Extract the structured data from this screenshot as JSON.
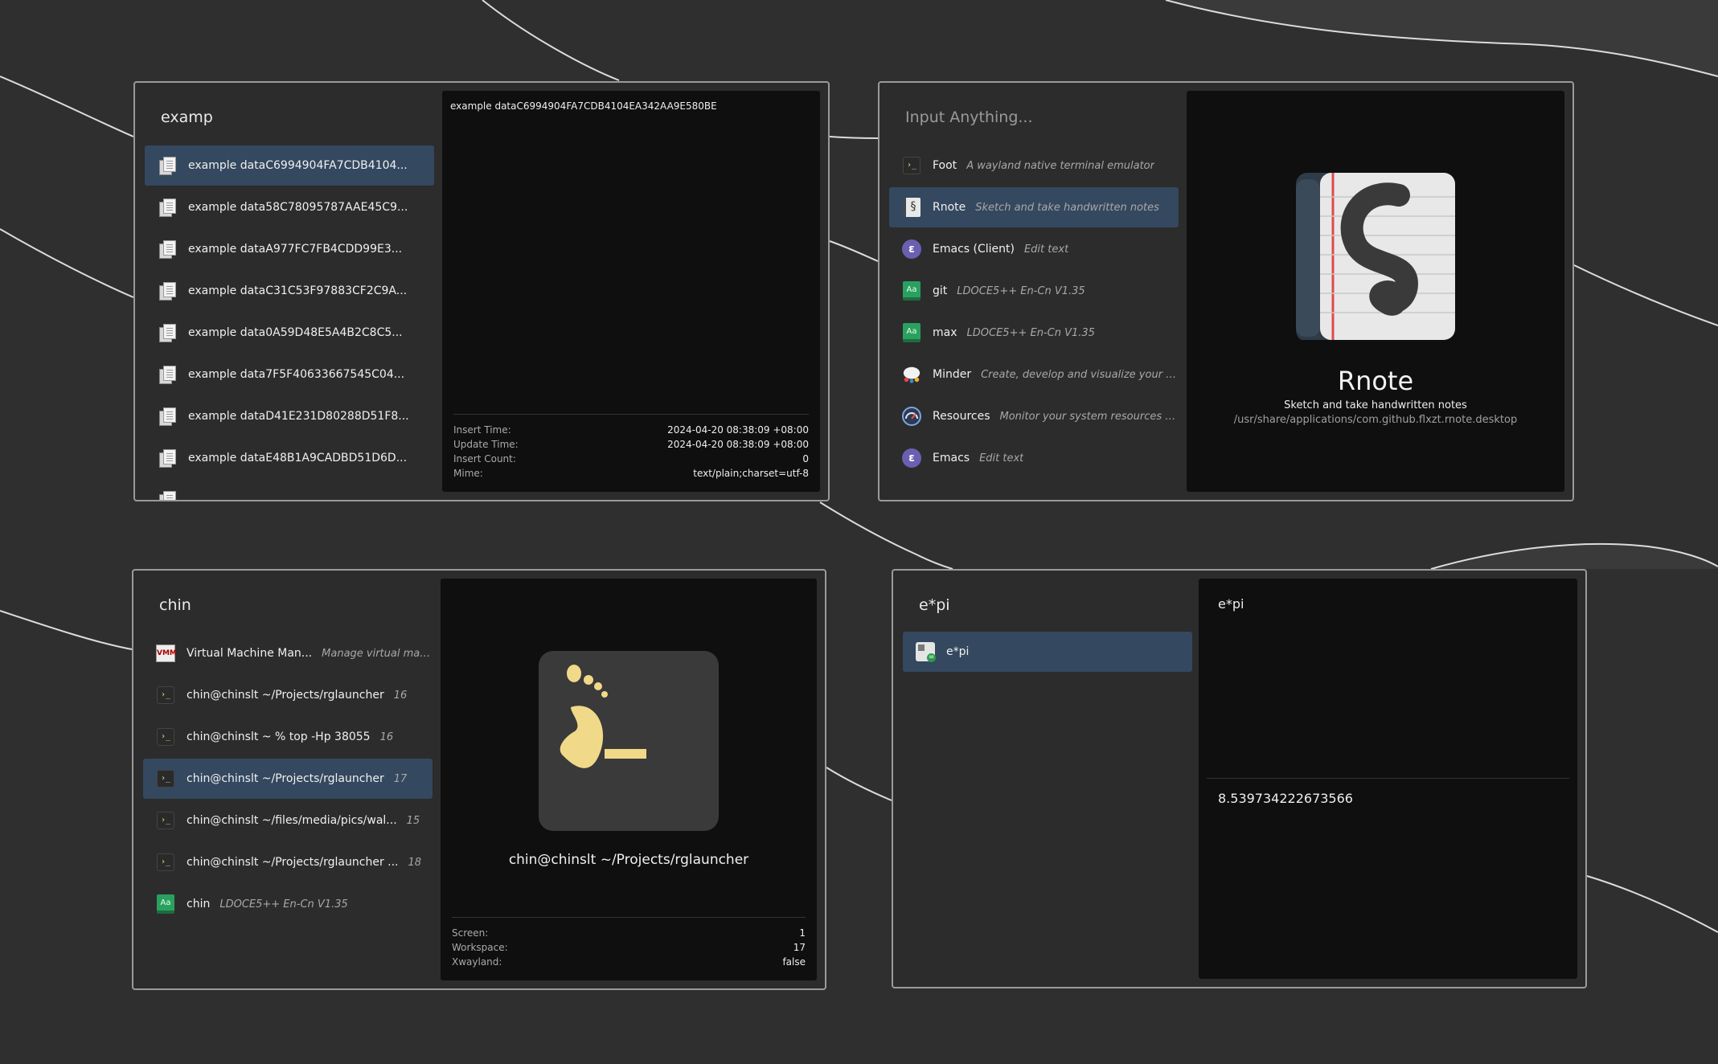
{
  "colors": {
    "background": "#2f2f2f",
    "window_bg": "#2c2c2c",
    "border": "#9a9a9a",
    "selection": "#34485f",
    "preview_bg": "#0f0f0f",
    "terminal_accent": "#f1d98a"
  },
  "clipboard": {
    "query": "examp",
    "items": [
      {
        "name": "example dataC6994904FA7CDB4104...",
        "icon": "clipboard-icon",
        "selected": true
      },
      {
        "name": "example data58C78095787AAE45C9...",
        "icon": "clipboard-icon"
      },
      {
        "name": "example dataA977FC7FB4CDD99E3...",
        "icon": "clipboard-icon"
      },
      {
        "name": "example dataC31C53F97883CF2C9A...",
        "icon": "clipboard-icon"
      },
      {
        "name": "example data0A59D48E5A4B2C8C5...",
        "icon": "clipboard-icon"
      },
      {
        "name": "example data7F5F40633667545C04...",
        "icon": "clipboard-icon"
      },
      {
        "name": "example dataD41E231D80288D51F8...",
        "icon": "clipboard-icon"
      },
      {
        "name": "example dataE48B1A9CADBD51D6D...",
        "icon": "clipboard-icon"
      }
    ],
    "preview_text": "example dataC6994904FA7CDB4104EA342AA9E580BE",
    "info": [
      {
        "key": "Insert Time:",
        "value": "2024-04-20 08:38:09 +08:00"
      },
      {
        "key": "Update Time:",
        "value": "2024-04-20 08:38:09 +08:00"
      },
      {
        "key": "Insert Count:",
        "value": "0"
      },
      {
        "key": "Mime:",
        "value": "text/plain;charset=utf-8"
      }
    ]
  },
  "apps": {
    "placeholder": "Input Anything...",
    "items": [
      {
        "name": "Foot",
        "desc": "A wayland native terminal emulator",
        "icon": "terminal-icon"
      },
      {
        "name": "Rnote",
        "desc": "Sketch and take handwritten notes",
        "icon": "rnote-icon",
        "selected": true
      },
      {
        "name": "Emacs (Client)",
        "desc": "Edit text",
        "icon": "emacs-icon"
      },
      {
        "name": "git",
        "desc": "LDOCE5++ En-Cn V1.35",
        "icon": "dictionary-icon"
      },
      {
        "name": "max",
        "desc": "LDOCE5++ En-Cn V1.35",
        "icon": "dictionary-icon"
      },
      {
        "name": "Minder",
        "desc": "Create, develop and visualize your i...",
        "icon": "minder-icon"
      },
      {
        "name": "Resources",
        "desc": "Monitor your system resources a...",
        "icon": "resources-gauge-icon"
      },
      {
        "name": "Emacs",
        "desc": "Edit text",
        "icon": "emacs-icon"
      }
    ],
    "preview": {
      "title": "Rnote",
      "subtitle": "Sketch and take handwritten notes",
      "path": "/usr/share/applications/com.github.flxzt.rnote.desktop"
    }
  },
  "windows": {
    "query": "chin",
    "items": [
      {
        "name": "Virtual Machine Man...",
        "desc": "Manage virtual mac...",
        "badge": "",
        "icon": "virt-manager-icon"
      },
      {
        "name": "chin@chinslt ~/Projects/rglauncher",
        "desc": "",
        "badge": "16",
        "icon": "terminal-icon"
      },
      {
        "name": "chin@chinslt ~ % top -Hp 38055",
        "desc": "",
        "badge": "16",
        "icon": "terminal-icon"
      },
      {
        "name": "chin@chinslt ~/Projects/rglauncher",
        "desc": "",
        "badge": "17",
        "icon": "terminal-icon",
        "selected": true
      },
      {
        "name": "chin@chinslt ~/files/media/pics/wal...",
        "desc": "",
        "badge": "15",
        "icon": "terminal-icon"
      },
      {
        "name": "chin@chinslt ~/Projects/rglauncher ...",
        "desc": "",
        "badge": "18",
        "icon": "terminal-icon"
      },
      {
        "name": "chin",
        "desc": "LDOCE5++ En-Cn V1.35",
        "badge": "",
        "icon": "dictionary-icon"
      }
    ],
    "preview": {
      "title": "chin@chinslt ~/Projects/rglauncher"
    },
    "info": [
      {
        "key": "Screen:",
        "value": "1"
      },
      {
        "key": "Workspace:",
        "value": "17"
      },
      {
        "key": "Xwayland:",
        "value": "false"
      }
    ]
  },
  "calculator": {
    "query": "e*pi",
    "items": [
      {
        "name": "e*pi",
        "icon": "calculator-icon",
        "selected": true
      }
    ],
    "preview_expr": "e*pi",
    "result": "8.539734222673566"
  }
}
